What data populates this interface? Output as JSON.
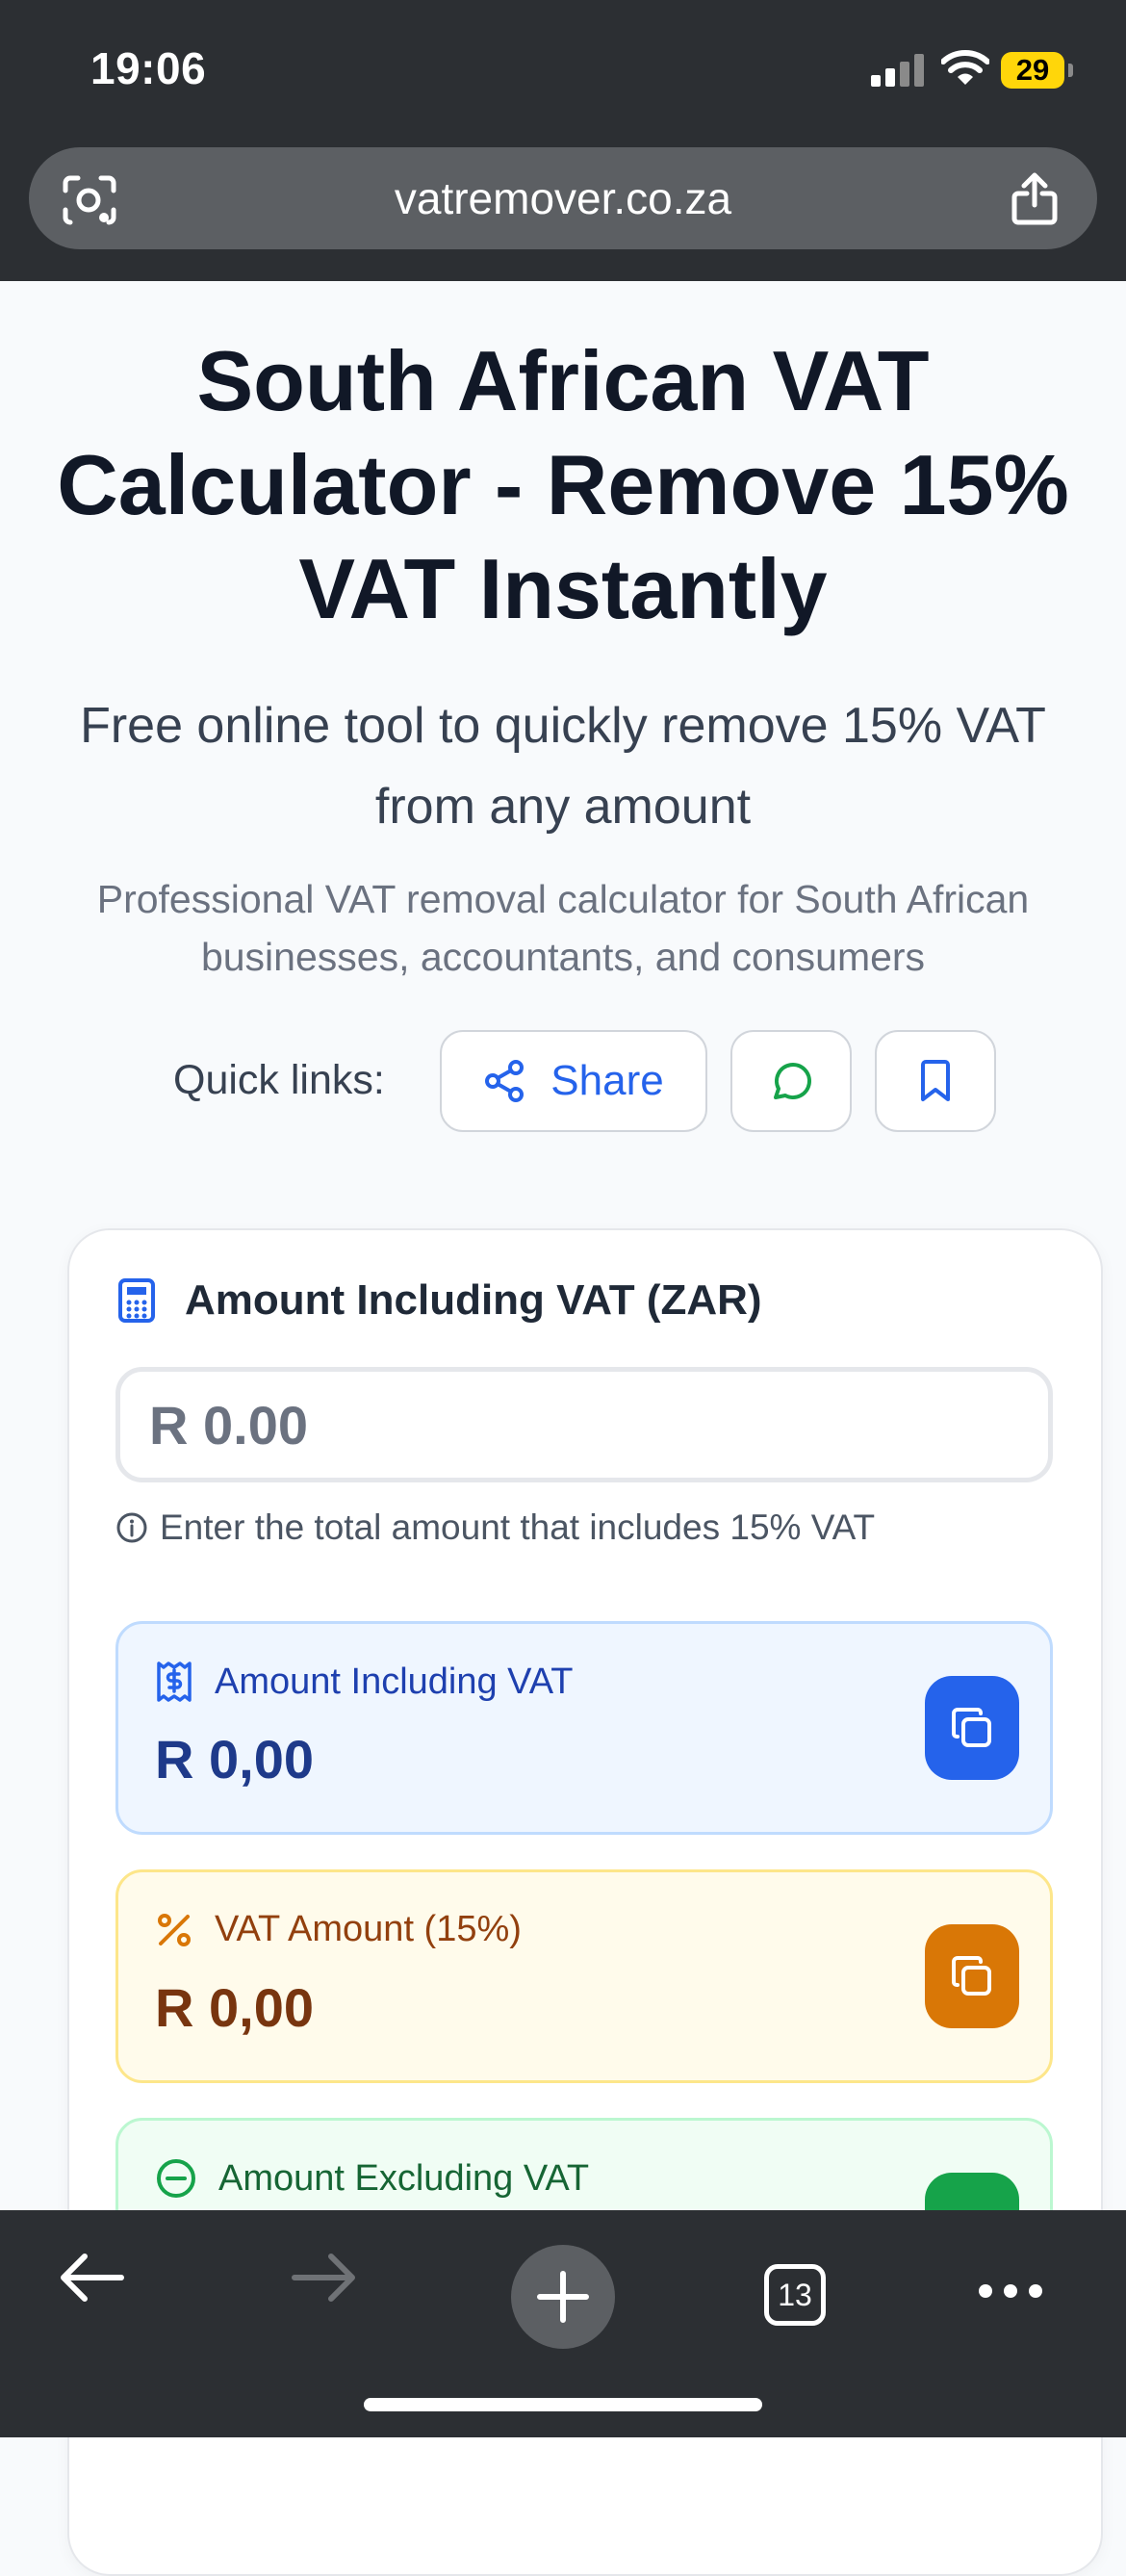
{
  "status_bar": {
    "time": "19:06",
    "battery": "29"
  },
  "browser": {
    "url": "vatremover.co.za",
    "open_tabs": "13"
  },
  "page": {
    "title": "South African VAT Calculator - Remove 15% VAT Instantly",
    "subtitle": "Free online tool to quickly remove 15% VAT from any amount",
    "description": "Professional VAT removal calculator for South African businesses, accountants, and consumers",
    "quick_links": {
      "label": "Quick links:",
      "share_label": "Share"
    }
  },
  "calculator": {
    "input_label": "Amount Including VAT (ZAR)",
    "input_placeholder": "R 0.00",
    "input_hint": "Enter the total amount that includes 15% VAT",
    "results": {
      "including": {
        "label": "Amount Including VAT",
        "value": "R 0,00"
      },
      "vat": {
        "label": "VAT Amount (15%)",
        "value": "R 0,00"
      },
      "excluding": {
        "label": "Amount Excluding VAT"
      }
    }
  },
  "colors": {
    "accent_blue": "#2563eb",
    "accent_amber": "#d97706",
    "accent_green": "#16a34a",
    "browser_chrome": "#2c2f33"
  }
}
